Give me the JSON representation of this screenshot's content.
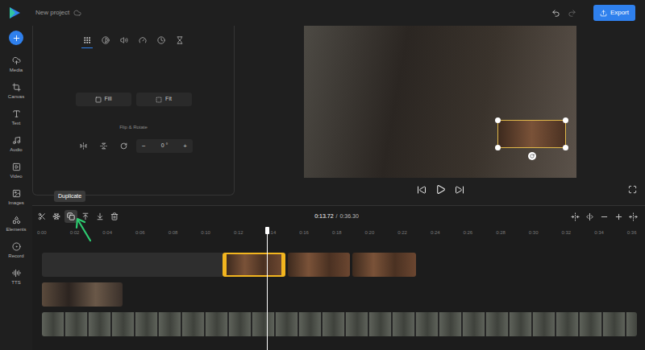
{
  "app": {
    "project_name": "New project",
    "export_button": "Export"
  },
  "sidebar": {
    "items": [
      {
        "label": "Media",
        "selected": false
      },
      {
        "label": "Canvas",
        "selected": false
      },
      {
        "label": "Text",
        "selected": false
      },
      {
        "label": "Audio",
        "selected": false
      },
      {
        "label": "Video",
        "selected": false
      },
      {
        "label": "Images",
        "selected": false
      },
      {
        "label": "Elements",
        "selected": false
      },
      {
        "label": "Record",
        "selected": false
      },
      {
        "label": "TTS",
        "selected": false
      }
    ]
  },
  "properties": {
    "tabs": [
      {
        "selected": true
      },
      {
        "selected": false
      },
      {
        "selected": false
      },
      {
        "selected": false
      },
      {
        "selected": false
      },
      {
        "selected": false
      }
    ],
    "fit_buttons": [
      {
        "label": "Fill",
        "selected": false
      },
      {
        "label": "Fit",
        "selected": false
      }
    ],
    "section_title": "Flip & Rotate",
    "rotation": {
      "decrement": "−",
      "value": "0",
      "unit": "°",
      "increment": "+"
    }
  },
  "preview": {
    "overlay_selected": true
  },
  "player": {
    "current_time": "0:13.72",
    "separator": "/",
    "duration": "0:36.30"
  },
  "timeline": {
    "tools": [
      {
        "hovered": false
      },
      {
        "hovered": false
      },
      {
        "hovered": true
      },
      {
        "hovered": false
      },
      {
        "hovered": false
      },
      {
        "hovered": false
      }
    ],
    "tooltip": "Duplicate",
    "ruler": [
      "0:00",
      "0:02",
      "0:04",
      "0:06",
      "0:08",
      "0:10",
      "0:12",
      "0:14",
      "0:16",
      "0:18",
      "0:20",
      "0:22",
      "0:24",
      "0:26",
      "0:28",
      "0:30",
      "0:32",
      "0:34",
      "0:36"
    ],
    "playhead": {
      "level": 0.378
    },
    "tracks": [
      {
        "kind": "overlay",
        "clips": [
          {
            "selected": true
          },
          {
            "selected": false
          },
          {
            "selected": false
          }
        ]
      },
      {
        "kind": "image",
        "clips": [
          {
            "selected": false
          }
        ]
      },
      {
        "kind": "video",
        "clips": [
          {
            "selected": false
          }
        ]
      }
    ]
  }
}
